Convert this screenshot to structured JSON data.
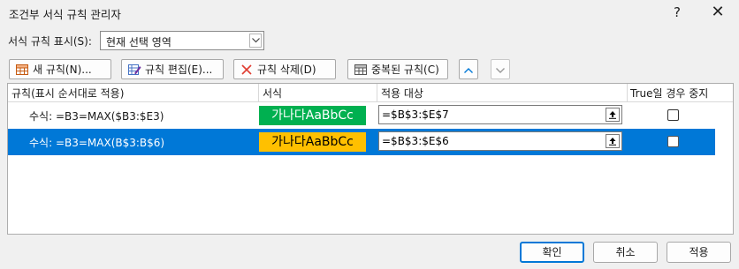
{
  "window": {
    "title": "조건부 서식 규칙 관리자",
    "help_label": "?",
    "close_label": "✕"
  },
  "show_rules": {
    "label": "서식 규칙 표시(S):",
    "selected": "현재 선택 영역"
  },
  "toolbar": {
    "new_rule": "새 규칙(N)...",
    "edit_rule": "규칙 편집(E)...",
    "delete_rule": "규칙 삭제(D)",
    "duplicate_rule": "중복된 규칙(C)",
    "move_up_icon": "chevron-up-icon",
    "move_down_icon": "chevron-down-icon"
  },
  "columns": {
    "rule": "규칙(표시 순서대로 적용)",
    "format": "서식",
    "applies_to": "적용 대상",
    "stop_if_true": "True일 경우 중지"
  },
  "rules": [
    {
      "rule": "수식: =B3=MAX($B3:$E3)",
      "preview": "가나다AaBbCc",
      "preview_color": "#00b050",
      "applies_to": "=$B$3:$E$7",
      "stop_if_true": false,
      "selected": false
    },
    {
      "rule": "수식: =B3=MAX(B$3:B$6)",
      "preview": "가나다AaBbCc",
      "preview_color": "#ffc000",
      "applies_to": "=$B$3:$E$6",
      "stop_if_true": false,
      "selected": true
    }
  ],
  "footer": {
    "ok": "확인",
    "cancel": "취소",
    "apply": "적용"
  },
  "colors": {
    "selection": "#0078d7",
    "dialog_bg": "#f0f0f0"
  }
}
